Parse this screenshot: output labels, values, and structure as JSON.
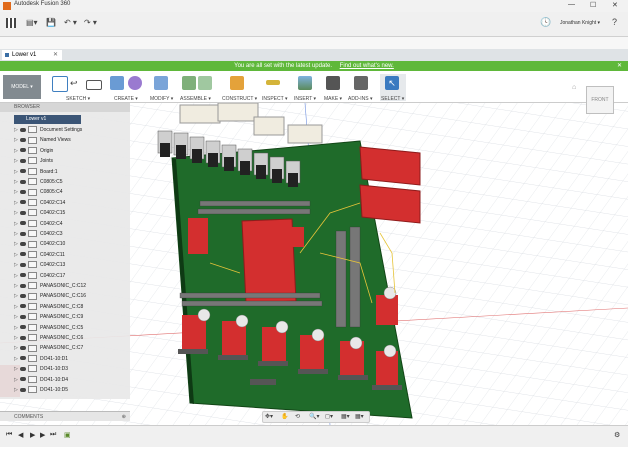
{
  "app": {
    "title": "Autodesk Fusion 360",
    "window_controls": [
      "—",
      "☐",
      "✕"
    ]
  },
  "quick_access": {
    "user": "Jonathan Knight ▾",
    "undo": "↶ ▾",
    "redo": "↷ ▾",
    "help": "?"
  },
  "doc_tab": {
    "name": "Lower v1",
    "close": "✕"
  },
  "banner": {
    "text": "You are all set with the latest update.",
    "link": "Find out what's new.",
    "close": "✕"
  },
  "workspace": "MODEL ▾",
  "toolbar_groups": [
    {
      "label": "SKETCH ▾",
      "color": "#3f7fc0"
    },
    {
      "label": "CREATE ▾",
      "color": "#6a9bd4"
    },
    {
      "label": "MODIFY ▾",
      "color": "#7aa4d8"
    },
    {
      "label": "ASSEMBLE ▾",
      "color": "#7fb07a"
    },
    {
      "label": "CONSTRUCT ▾",
      "color": "#e4a23a"
    },
    {
      "label": "INSPECT ▾",
      "color": "#d4b43a"
    },
    {
      "label": "INSERT ▾",
      "color": "#5a8a5a"
    },
    {
      "label": "MAKE ▾",
      "color": "#555"
    },
    {
      "label": "ADD-INS ▾",
      "color": "#666"
    },
    {
      "label": "SELECT ▾",
      "color": "#3a7ac0"
    }
  ],
  "viewcube": "FRONT",
  "browser": {
    "header": "BROWSER",
    "root": "Lower v1",
    "items": [
      "Document Settings",
      "Named Views",
      "Origin",
      "Joints",
      "Board:1",
      "C0805:C5",
      "C0805:C4",
      "C0402:C14",
      "C0402:C15",
      "C0402:C4",
      "C0402:C3",
      "C0402:C10",
      "C0402:C11",
      "C0402:C13",
      "C0402:C17",
      "PANASONIC_C:C12",
      "PANASONIC_C:C16",
      "PANASONIC_C:C8",
      "PANASONIC_C:C9",
      "PANASONIC_C:C5",
      "PANASONIC_C:C6",
      "PANASONIC_C:C7",
      "DO41-10:D1",
      "DO41-10:D3",
      "DO41-10:D4",
      "DO41-10:D5"
    ]
  },
  "comments": {
    "label": "COMMENTS"
  },
  "nav_tools": [
    "✥▾",
    "✋",
    "⟲",
    "🔍▾",
    "◻▾",
    "▦▾",
    "▦▾"
  ],
  "timeline": [
    "⏮",
    "◀",
    "▶",
    "▶",
    "⏭",
    "⚙"
  ],
  "colors": {
    "board": "#1f6b2a",
    "red_parts": "#c62828",
    "accent": "#5fb83a"
  }
}
